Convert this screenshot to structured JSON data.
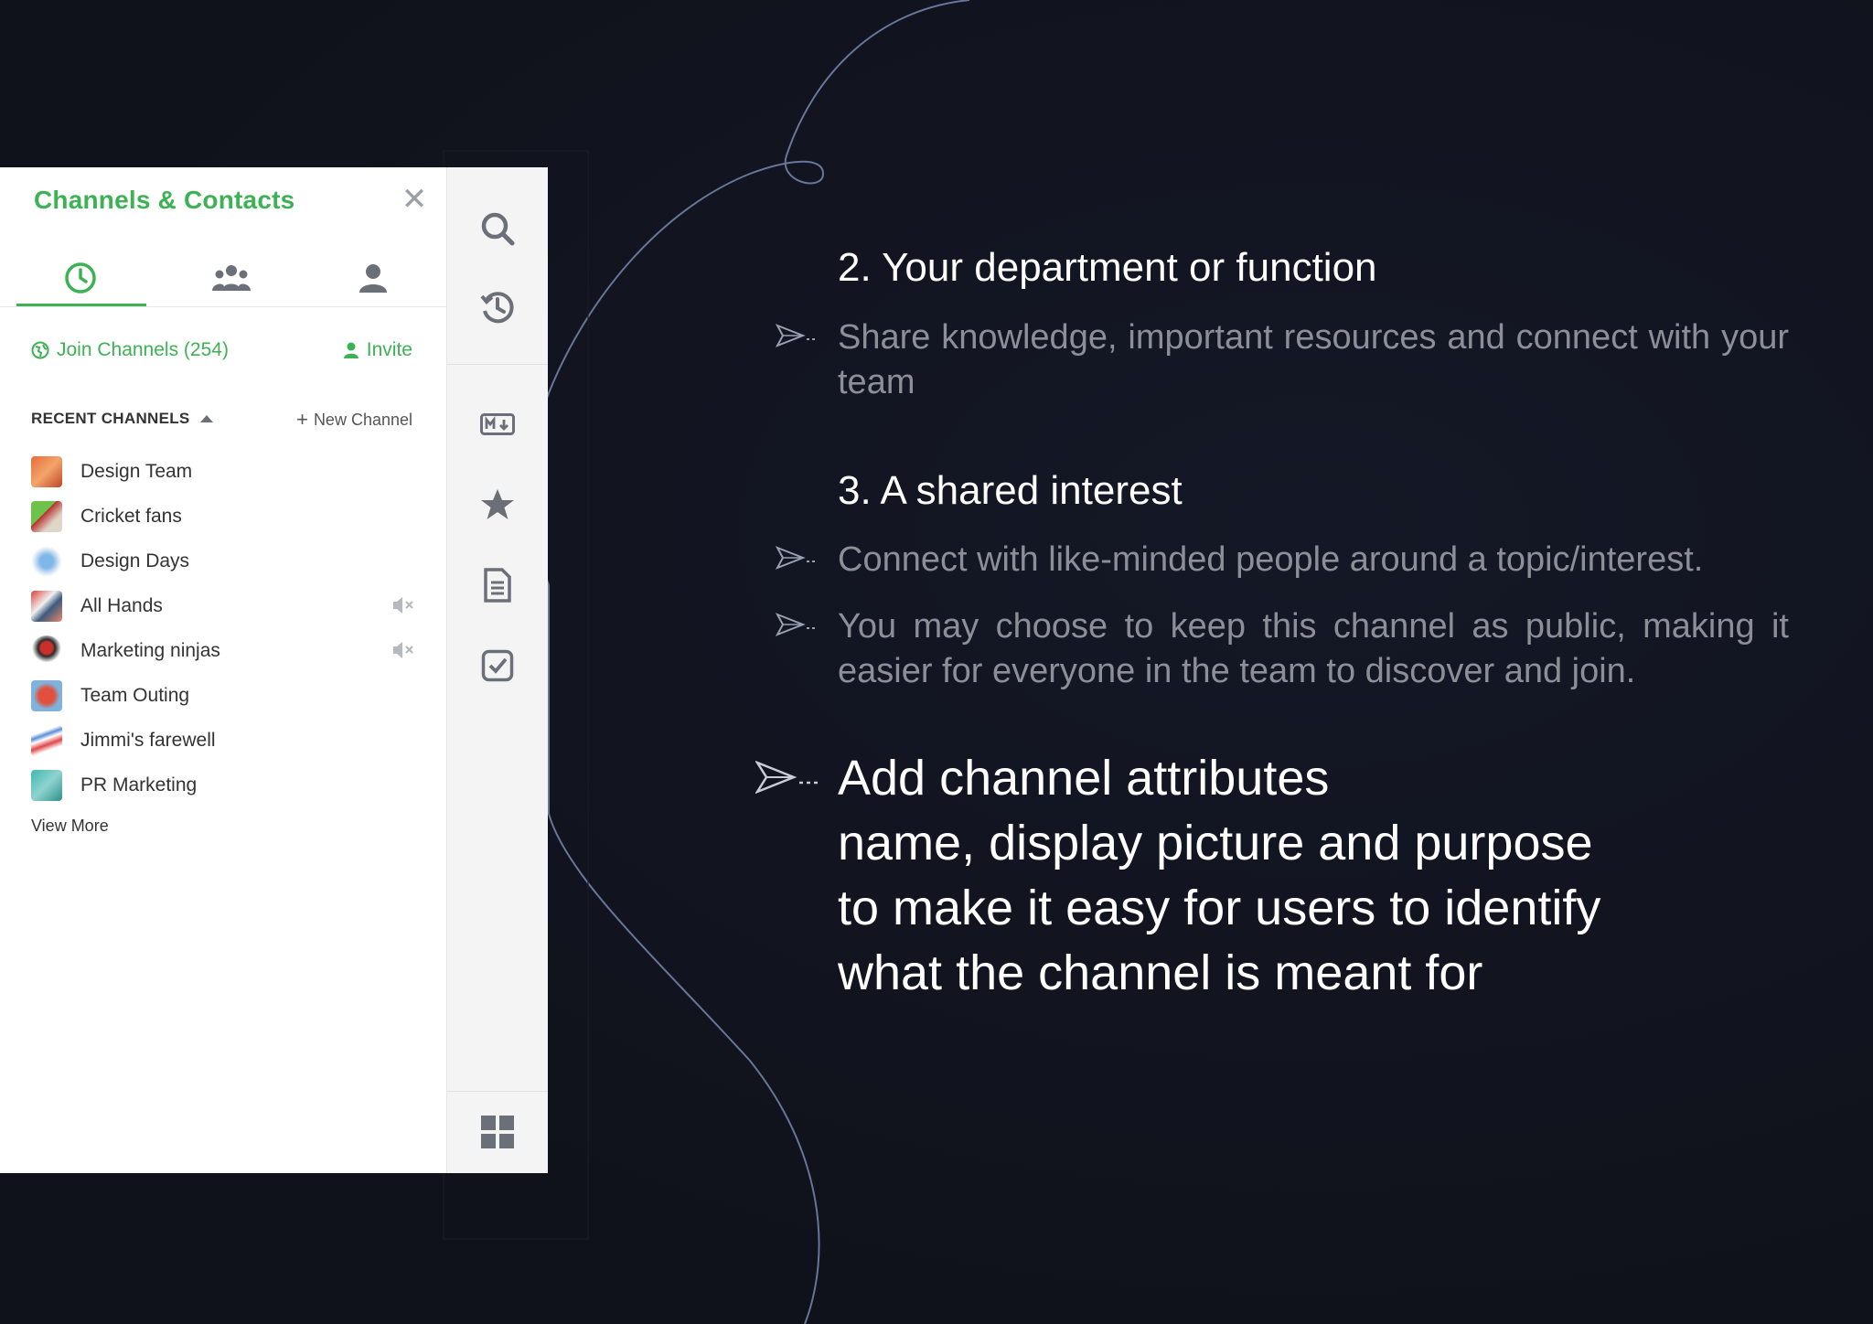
{
  "panel": {
    "title": "Channels & Contacts",
    "join_channels": "Join Channels (254)",
    "invite": "Invite",
    "recent_channels": "RECENT CHANNELS",
    "new_channel": "New Channel",
    "view_more": "View More",
    "channels": [
      {
        "name": "Design Team",
        "muted": false
      },
      {
        "name": "Cricket fans",
        "muted": false
      },
      {
        "name": "Design Days",
        "muted": false
      },
      {
        "name": "All Hands",
        "muted": true
      },
      {
        "name": "Marketing ninjas",
        "muted": true
      },
      {
        "name": "Team Outing",
        "muted": false
      },
      {
        "name": "Jimmi's farewell",
        "muted": false
      },
      {
        "name": "PR Marketing",
        "muted": false
      }
    ]
  },
  "rail": {
    "icons": [
      "search-icon",
      "history-icon",
      "markdown-icon",
      "star-icon",
      "notes-icon",
      "tasks-icon",
      "apps-grid-icon"
    ]
  },
  "content": {
    "section2_title": "2. Your department or function",
    "section2_text": "Share knowledge, important resources and connect with your team",
    "section3_title": "3. A shared interest",
    "section3_bullet1": "Connect with like-minded people around a topic/interest.",
    "section3_bullet2": "You may choose to keep this channel as public, making it easier for everyone in the team to discover and join.",
    "attributes": {
      "line1": "Add channel attributes",
      "line2": "name, display picture and purpose",
      "line3": "to make it easy for users to identify",
      "line4": "what the channel is meant for"
    }
  },
  "colors": {
    "accent": "#3db255",
    "background": "#10121b",
    "muted_text": "#8d8f98"
  }
}
